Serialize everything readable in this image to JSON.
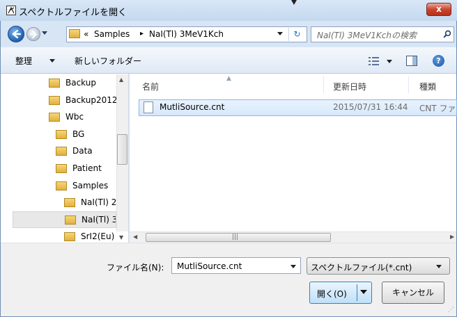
{
  "window": {
    "title": "スペクトルファイルを開く",
    "close_label": "x"
  },
  "address": {
    "chevron": "«",
    "crumbs": [
      "Samples",
      "NaI(Tl) 3MeV1Kch"
    ],
    "separator": "▸",
    "refresh_glyph": "↻",
    "search_placeholder": "NaI(Tl) 3MeV1Kchの検索"
  },
  "toolbar": {
    "organize_label": "整理",
    "new_folder_label": "新しいフォルダー",
    "help_glyph": "?"
  },
  "nav_tree": {
    "items": [
      {
        "label": "Backup",
        "indent": 0
      },
      {
        "label": "Backup2012",
        "indent": 0
      },
      {
        "label": "Wbc",
        "indent": 0
      },
      {
        "label": "BG",
        "indent": 1
      },
      {
        "label": "Data",
        "indent": 1
      },
      {
        "label": "Patient",
        "indent": 1
      },
      {
        "label": "Samples",
        "indent": 1
      },
      {
        "label": "NaI(Tl) 2",
        "indent": 2
      },
      {
        "label": "NaI(Tl) 3",
        "indent": 2,
        "selected": true
      },
      {
        "label": "SrI2(Eu)",
        "indent": 2
      }
    ]
  },
  "columns": {
    "name": "名前",
    "date": "更新日時",
    "type": "種類"
  },
  "files": [
    {
      "name": "MutliSource.cnt",
      "date": "2015/07/31 16:44",
      "type": "CNT ファ"
    }
  ],
  "bottom": {
    "filename_label": "ファイル名(N):",
    "filename_value": "MutliSource.cnt",
    "filter_value": "スペクトルファイル(*.cnt)",
    "open_label": "開く(O)",
    "cancel_label": "キャンセル"
  },
  "colors": {
    "frame": "#cfe0f3",
    "close_button": "#c9452f",
    "selection": "#d6e8fc",
    "folder": "#e1b13e"
  },
  "icons": [
    "app-icon",
    "back-icon",
    "forward-icon",
    "folder-icon",
    "refresh-icon",
    "search-icon",
    "view-icon",
    "preview-pane-icon",
    "help-icon",
    "file-icon"
  ]
}
